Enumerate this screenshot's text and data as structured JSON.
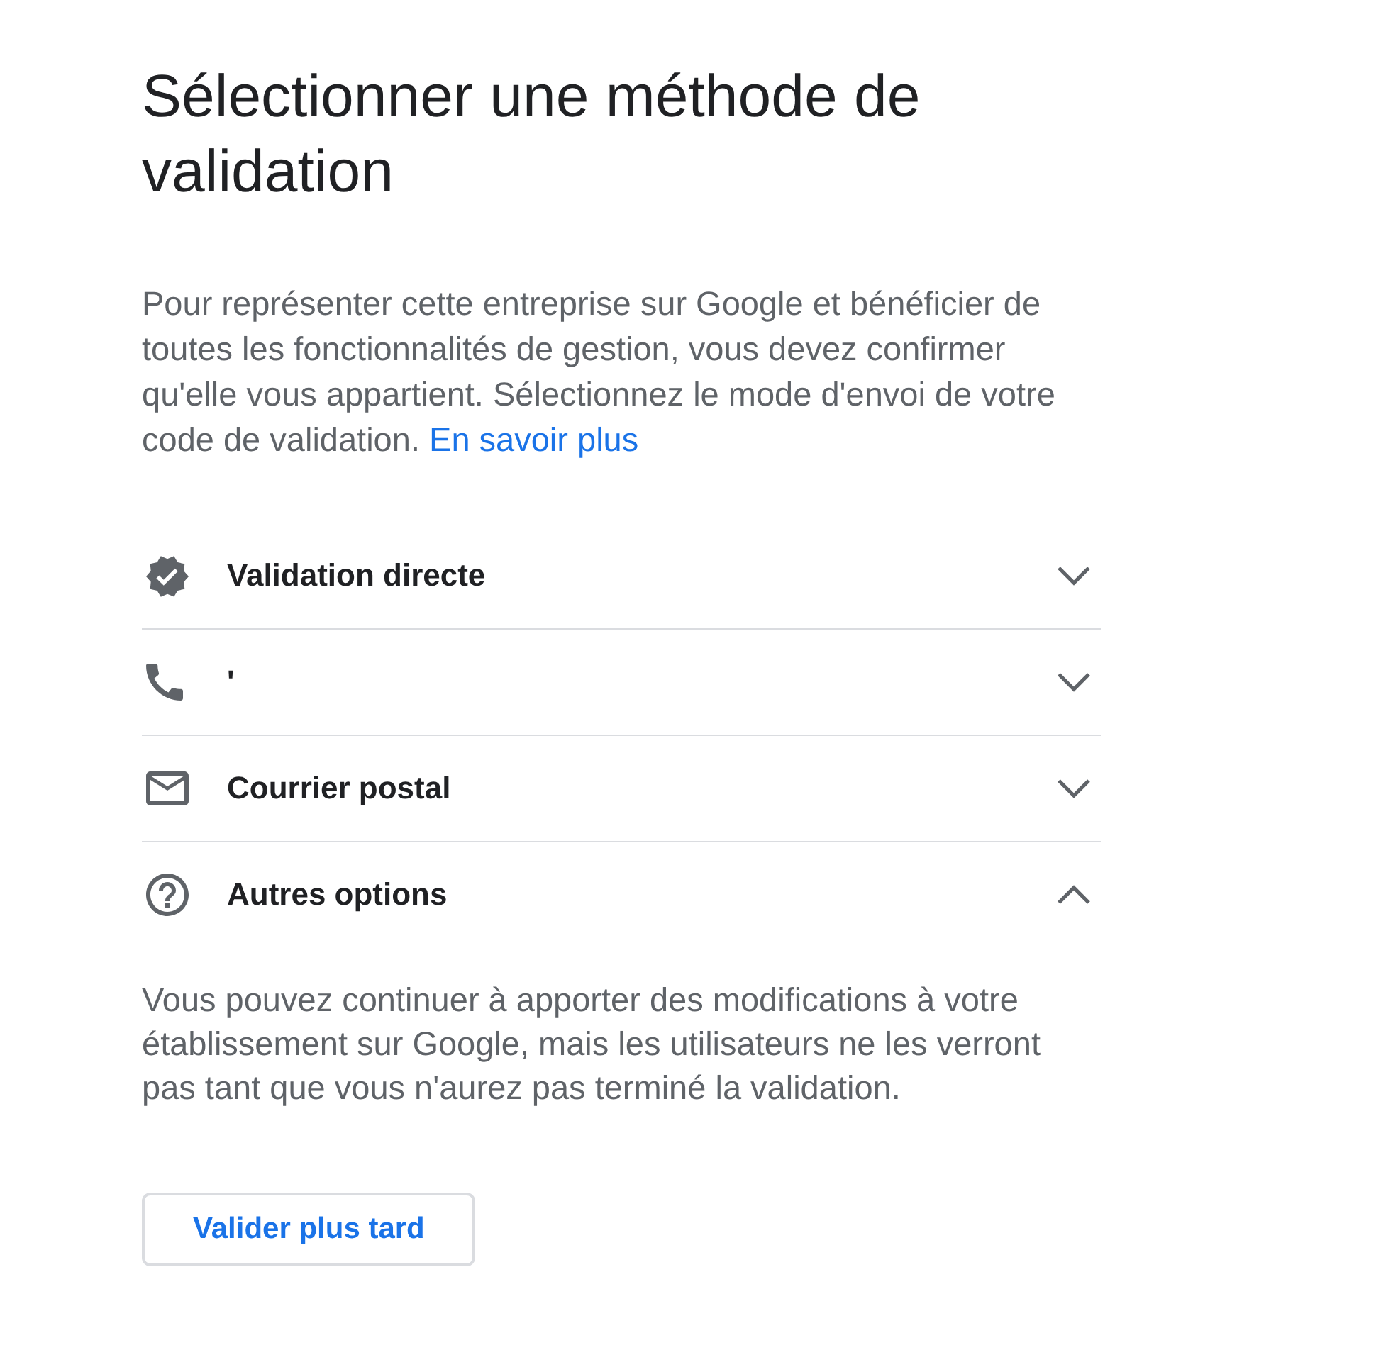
{
  "page": {
    "title": "Sélectionner une méthode de validation",
    "intro": "Pour représenter cette entreprise sur Google et bénéficier de toutes les fonctionnalités de gestion, vous devez confirmer qu'elle vous appartient. Sélectionnez le mode d'envoi de votre code de validation.",
    "learn_more_link": "En savoir plus"
  },
  "methods": [
    {
      "kind": "direct",
      "label": "Validation directe",
      "expanded": false
    },
    {
      "kind": "phone",
      "label": "'",
      "expanded": false
    },
    {
      "kind": "mail",
      "label": "Courrier postal",
      "expanded": false
    },
    {
      "kind": "other",
      "label": "Autres options",
      "expanded": true,
      "details": "Vous pouvez continuer à apporter des modifications à votre établissement sur Google, mais les utilisateurs ne les verront pas tant que vous n'aurez pas terminé la validation."
    }
  ],
  "buttons": [
    {
      "label": "Valider plus tard"
    }
  ]
}
